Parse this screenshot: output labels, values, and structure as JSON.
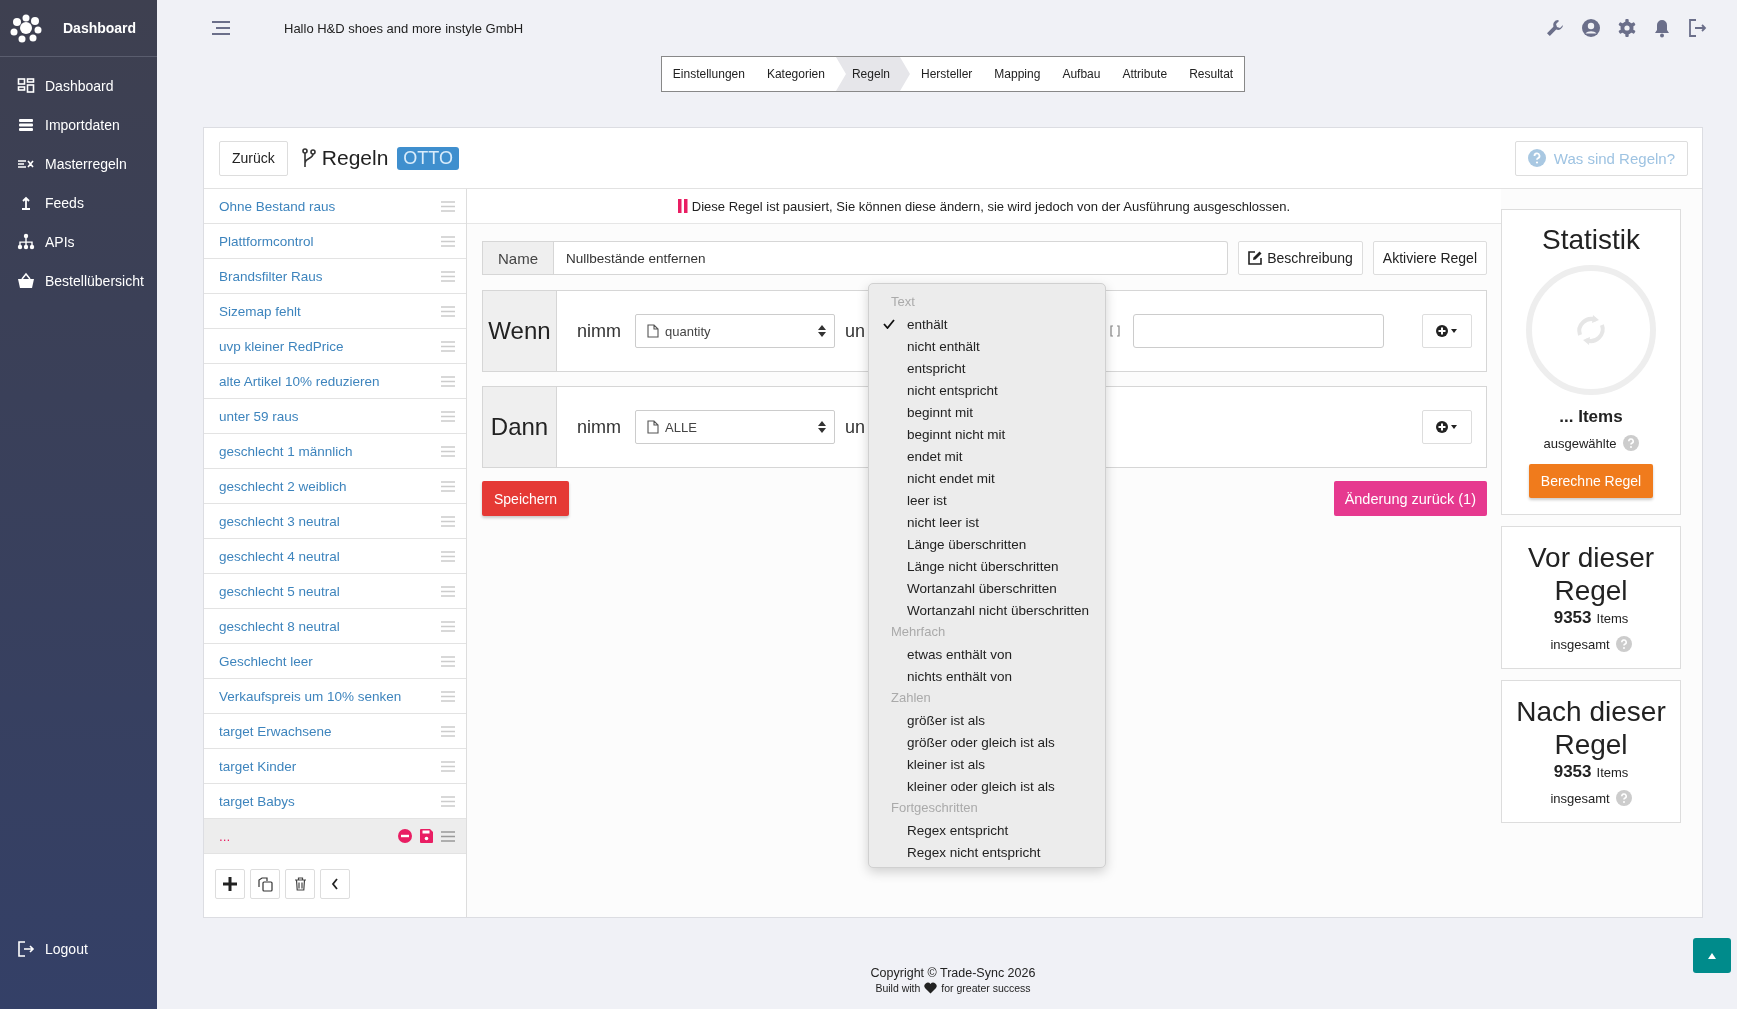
{
  "sidebar": {
    "brand": "Dashboard",
    "items": [
      {
        "label": "Dashboard",
        "kind": "grid"
      },
      {
        "label": "Importdaten",
        "kind": "stack"
      },
      {
        "label": "Masterregeln",
        "kind": "rules"
      },
      {
        "label": "Feeds",
        "kind": "upload"
      },
      {
        "label": "APIs",
        "kind": "tree"
      },
      {
        "label": "Bestellübersicht",
        "kind": "basket"
      }
    ],
    "logout": "Logout"
  },
  "topbar": {
    "greeting": "Hallo H&D shoes and more instyle GmbH"
  },
  "tabs": [
    {
      "label": "Einstellungen",
      "selected": false
    },
    {
      "label": "Kategorien",
      "selected": false
    },
    {
      "label": "Regeln",
      "selected": true
    },
    {
      "label": "Hersteller",
      "selected": false
    },
    {
      "label": "Mapping",
      "selected": false
    },
    {
      "label": "Aufbau",
      "selected": false
    },
    {
      "label": "Attribute",
      "selected": false
    },
    {
      "label": "Resultat",
      "selected": false
    }
  ],
  "header": {
    "back": "Zurück",
    "title": "Regeln",
    "badge": "OTTO",
    "help": "Was sind Regeln?"
  },
  "rules": [
    {
      "name": "Ohne Bestand raus",
      "selected": false
    },
    {
      "name": "Plattformcontrol",
      "selected": false
    },
    {
      "name": "Brandsfilter Raus",
      "selected": false
    },
    {
      "name": "Sizemap fehlt",
      "selected": false
    },
    {
      "name": "uvp kleiner RedPrice",
      "selected": false
    },
    {
      "name": "alte Artikel 10% reduzieren",
      "selected": false
    },
    {
      "name": "unter 59 raus",
      "selected": false
    },
    {
      "name": "geschlecht 1 männlich",
      "selected": false
    },
    {
      "name": "geschlecht 2 weiblich",
      "selected": false
    },
    {
      "name": "geschlecht 3 neutral",
      "selected": false
    },
    {
      "name": "geschlecht 4 neutral",
      "selected": false
    },
    {
      "name": "geschlecht 5 neutral",
      "selected": false
    },
    {
      "name": "geschlecht 8 neutral",
      "selected": false
    },
    {
      "name": "Geschlecht leer",
      "selected": false
    },
    {
      "name": "Verkaufspreis um 10% senken",
      "selected": false
    },
    {
      "name": "target Erwachsene",
      "selected": false
    },
    {
      "name": "target Kinder",
      "selected": false
    },
    {
      "name": "target Babys",
      "selected": false
    },
    {
      "name": "...",
      "selected": true
    }
  ],
  "notice": "Diese Regel ist pausiert, Sie können diese ändern, sie wird jedoch von der Ausführung ausgeschlossen.",
  "name_field": {
    "label": "Name",
    "value": "Nullbestände entfernen"
  },
  "actions": [
    {
      "label": "Beschreibung",
      "kind": "edit"
    },
    {
      "label": "Aktiviere Regel",
      "kind": "plain"
    }
  ],
  "blocks": [
    {
      "label": "Wenn",
      "verb": "nimm",
      "select": "quantity",
      "conjunction": "un",
      "kind": "condition"
    },
    {
      "label": "Dann",
      "verb": "nimm",
      "select": "ALLE",
      "conjunction": "un",
      "kind": "action"
    }
  ],
  "save": "Speichern",
  "undo": "Änderung zurück (1)",
  "dropdown": {
    "groups": [
      {
        "title": "Text",
        "options": [
          {
            "label": "enthält",
            "checked": true
          },
          {
            "label": "nicht enthält",
            "checked": false
          },
          {
            "label": "entspricht",
            "checked": false
          },
          {
            "label": "nicht entspricht",
            "checked": false
          },
          {
            "label": "beginnt mit",
            "checked": false
          },
          {
            "label": "beginnt nicht mit",
            "checked": false
          },
          {
            "label": "endet mit",
            "checked": false
          },
          {
            "label": "nicht endet mit",
            "checked": false
          },
          {
            "label": "leer ist",
            "checked": false
          },
          {
            "label": "nicht leer ist",
            "checked": false
          },
          {
            "label": "Länge überschritten",
            "checked": false
          },
          {
            "label": "Länge nicht überschritten",
            "checked": false
          },
          {
            "label": "Wortanzahl überschritten",
            "checked": false
          },
          {
            "label": "Wortanzahl nicht überschritten",
            "checked": false
          }
        ]
      },
      {
        "title": "Mehrfach",
        "options": [
          {
            "label": "etwas enthält von",
            "checked": false
          },
          {
            "label": "nichts enthält von",
            "checked": false
          }
        ]
      },
      {
        "title": "Zahlen",
        "options": [
          {
            "label": "größer ist als",
            "checked": false
          },
          {
            "label": "größer oder gleich ist als",
            "checked": false
          },
          {
            "label": "kleiner ist als",
            "checked": false
          },
          {
            "label": "kleiner oder gleich ist als",
            "checked": false
          }
        ]
      },
      {
        "title": "Fortgeschritten",
        "options": [
          {
            "label": "Regex entspricht",
            "checked": false
          },
          {
            "label": "Regex nicht entspricht",
            "checked": false
          }
        ]
      }
    ]
  },
  "stats": {
    "title": "Statistik",
    "count": "... Items",
    "caption": "ausgewählte",
    "button": "Berechne Regel"
  },
  "totals": [
    {
      "title": "Vor dieser Regel",
      "number": "9353",
      "unit": "Items",
      "caption": "insgesamt"
    },
    {
      "title": "Nach dieser Regel",
      "number": "9353",
      "unit": "Items",
      "caption": "insgesamt"
    }
  ],
  "footer": {
    "copyright": "Copyright © Trade-Sync 2026",
    "build_before": "Build with",
    "build_after": "for greater success"
  }
}
